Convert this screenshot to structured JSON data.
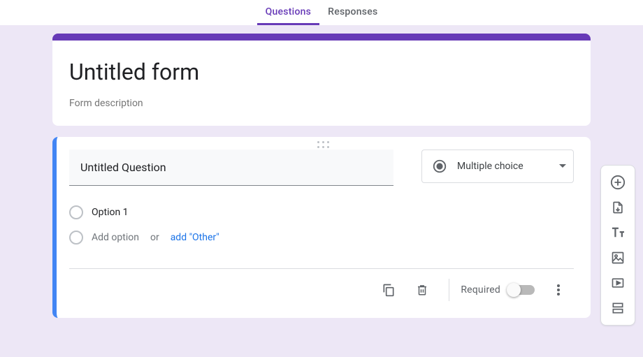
{
  "tabs": {
    "questions": "Questions",
    "responses": "Responses"
  },
  "header": {
    "title": "Untitled form",
    "descPlaceholder": "Form description"
  },
  "question": {
    "titleValue": "Untitled Question",
    "typeLabel": "Multiple choice",
    "options": {
      "first": "Option 1",
      "addOption": "Add option",
      "or": "or",
      "addOther": "add \"Other\""
    },
    "requiredLabel": "Required"
  }
}
